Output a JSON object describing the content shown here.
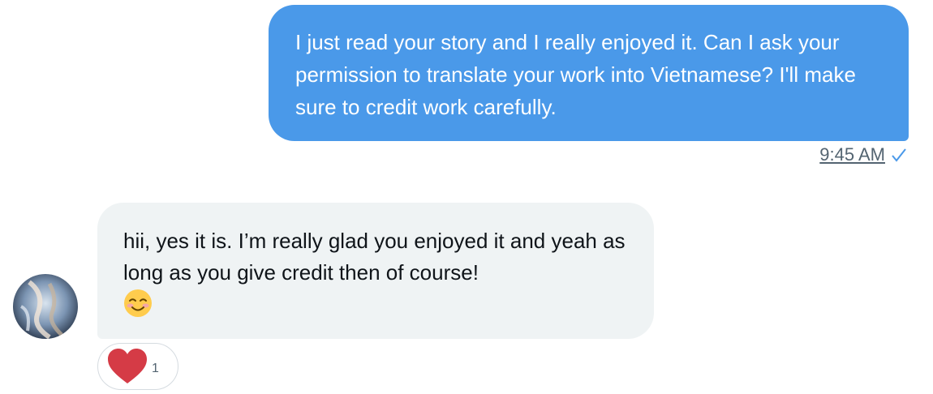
{
  "messages": {
    "outgoing": {
      "text": "I just read your story and I really enjoyed it. Can I ask your permission to translate your work into Vietnamese? I'll make sure to credit work carefully.",
      "time": "9:45 AM",
      "status_icon": "checkmark-icon"
    },
    "incoming": {
      "text": "hii, yes it is. I’m really glad you enjoyed it and yeah as long as you give credit then of course!",
      "emoji_icon": "smiling-face-with-blush-icon",
      "reaction": {
        "icon": "heart-icon",
        "count": "1",
        "color": "#d53b46"
      }
    }
  },
  "colors": {
    "outgoing_bubble": "#4a99e9",
    "incoming_bubble": "#eff3f4",
    "meta_text": "#536471",
    "check": "#4a99e9"
  }
}
